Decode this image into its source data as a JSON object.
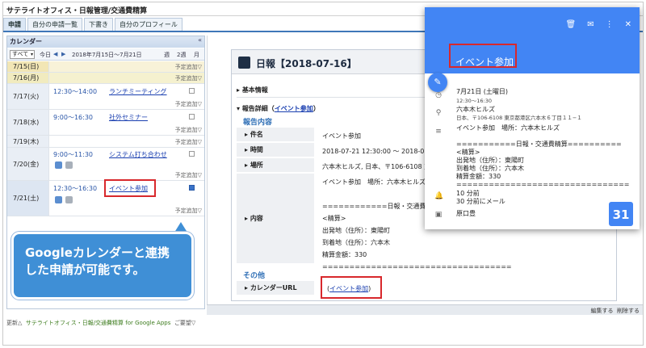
{
  "app": {
    "title": "サテライトオフィス・日報管理/交通費精算"
  },
  "tabs": [
    {
      "label": "申請"
    },
    {
      "label": "自分の申請一覧"
    },
    {
      "label": "下書き"
    },
    {
      "label": "自分のプロフィール"
    }
  ],
  "calendar": {
    "header": "カレンダー",
    "collapse": "«",
    "filter_value": "すべて",
    "today_label": "今日",
    "range_text": "2018年7月15日〜7月21日",
    "view_1": "週",
    "view_2": "2週",
    "view_3": "月",
    "add_label": "予定追加▽",
    "rows": [
      {
        "date": "7/15(日)",
        "time": "",
        "title": ""
      },
      {
        "date": "7/16(月)",
        "time": "",
        "title": ""
      },
      {
        "date": "7/17(火)",
        "time": "12:30〜14:00",
        "title": "ランチミーティング"
      },
      {
        "date": "7/18(水)",
        "time": "9:00〜16:30",
        "title": "社外セミナー"
      },
      {
        "date": "7/19(木)",
        "time": "",
        "title": ""
      },
      {
        "date": "7/20(金)",
        "time": "9:00〜11:30",
        "title": "システム打ち合わせ"
      },
      {
        "date": "7/21(土)",
        "time": "12:30〜16:30",
        "title": "イベント参加"
      }
    ]
  },
  "callout": {
    "line1": "Googleカレンダーと連携",
    "line2": "した申請が可能です。"
  },
  "report": {
    "title": "日報【2018-07-16】",
    "basic_info": "基本情報",
    "detail_label": "報告詳細（",
    "detail_link": "イベント参加",
    "detail_close": "）",
    "content_heading": "報告内容",
    "fields": [
      {
        "label": "件名",
        "value": "イベント参加"
      },
      {
        "label": "時間",
        "value": "2018-07-21 12:30:00 ～ 2018-07-"
      },
      {
        "label": "場所",
        "value": "六本木ヒルズ, 日本、〒106-6108 東"
      },
      {
        "label": "内容",
        "value": "イベント参加　場所：六本木ヒルズ\n\n============日報・交通費精算\n<精算>\n出発地（住所）：東陽町\n到着地（住所）：六本木\n精算金額：330\n==================================="
      }
    ],
    "other_heading": "その他",
    "calendar_url_label": "カレンダーURL",
    "calendar_url_open": "(",
    "calendar_url_link": "イベント参加",
    "calendar_url_close": ")",
    "edit_label": "編集する",
    "delete_label": "削除する"
  },
  "gpopup": {
    "title": "イベント参加",
    "date": "7月21日 (土曜日)",
    "time": "12:30〜16:30",
    "location_name": "六本木ヒルズ",
    "location_addr": "日本、〒106-6108 東京都港区六本木６丁目１１−１",
    "description": "イベント参加　場所：六本木ヒルズ\n\n===========日報・交通費精算==========\n<精算>\n出発地（住所）：東陽町\n到着地（住所）：六本木\n精算金額：330\n================================",
    "reminders": "10 分前\n30 分前にメール",
    "owner": "原口豊",
    "calendar_day": "31"
  },
  "footer": {
    "update": "更新△",
    "link": "サテライトオフィス・日報/交通費精算 for Google Apps",
    "request": "ご要望▽"
  },
  "colors": {
    "accent": "#3f77b8",
    "google_blue": "#4285f4",
    "highlight_red": "#d8282c",
    "callout_blue": "#3f8fd6"
  }
}
